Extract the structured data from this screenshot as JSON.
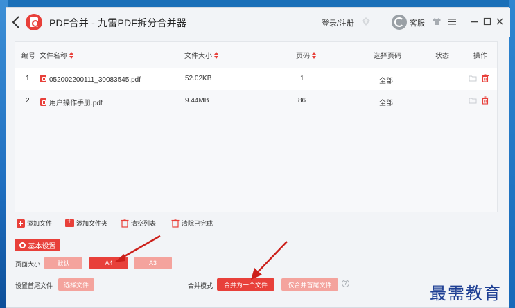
{
  "window": {
    "title": "PDF合并 - 九雷PDF拆分合并器",
    "login_label": "登录/注册",
    "service_label": "客服"
  },
  "table": {
    "columns": [
      "编号",
      "文件名称",
      "文件大小",
      "页码",
      "选择页码",
      "状态",
      "操作"
    ],
    "rows": [
      {
        "index": "1",
        "name": "052002200111_30083545.pdf",
        "size": "52.02KB",
        "pages": "1",
        "range": "全部",
        "status": ""
      },
      {
        "index": "2",
        "name": "用户操作手册.pdf",
        "size": "9.44MB",
        "pages": "86",
        "range": "全部",
        "status": ""
      }
    ]
  },
  "actions": {
    "add_file": "添加文件",
    "add_folder": "添加文件夹",
    "clear_list": "清空列表",
    "clear_done": "清除已完成"
  },
  "settings": {
    "button_label": "基本设置",
    "page_size_label": "页面大小",
    "page_size_options": [
      "默认",
      "A4",
      "A3"
    ],
    "page_size_selected": "A4",
    "cover_label": "设置首尾文件",
    "cover_button": "选择文件",
    "merge_mode_label": "合并模式",
    "merge_mode_options": [
      "合并为一个文件",
      "仅合并首尾文件"
    ],
    "merge_mode_selected": "合并为一个文件",
    "help_glyph": "?"
  },
  "watermark": "最需教育",
  "colors": {
    "accent": "#e8403a",
    "accent_light": "#f4a39d",
    "watermark": "#1e3f94"
  }
}
